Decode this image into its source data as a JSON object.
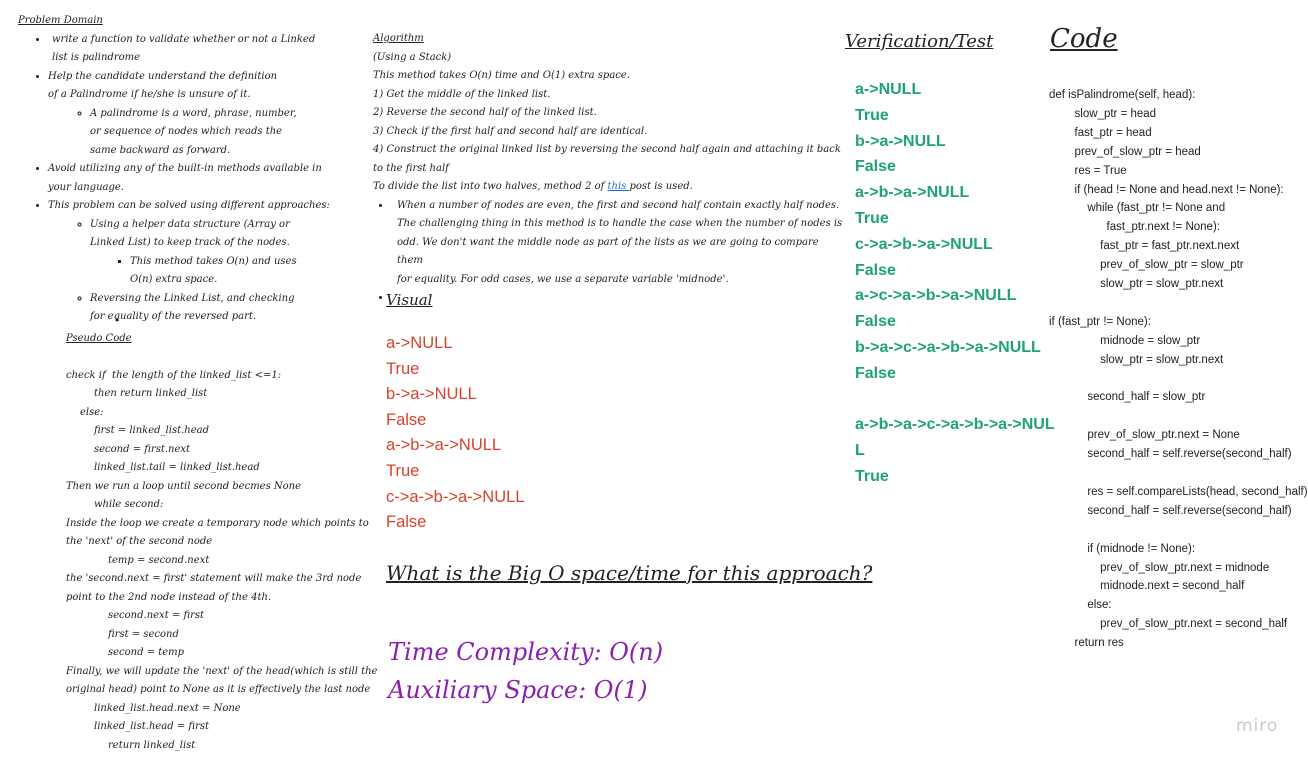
{
  "problem_domain": {
    "title": "Problem Domain",
    "bullets": [
      "write a function to validate whether or not a Linked list is palindrome",
      "Help the candidate understand the definition of a Palindrome if he/she is unsure of it.",
      "Avoid utilizing any of the built-in methods available in your language.",
      "This problem can be solved using different approaches:"
    ],
    "sub_palindrome": "A palindrome is a word, phrase, number, or sequence of nodes which reads the same backward as forward.",
    "sub_approach_1": "Using a helper data structure (Array or Linked List) to keep track of the nodes.",
    "sub_approach_1_note": "This method takes O(n) and uses O(n) extra space.",
    "sub_approach_2": "Reversing the Linked List, and checking for equality of the reversed part."
  },
  "pseudo": {
    "title": "Pseudo Code",
    "lines": [
      {
        "t": "check if  the length of the linked_list <=1:",
        "c": "plain",
        "i": 0
      },
      {
        "t": "then return linked_list",
        "c": "purple",
        "i": 2
      },
      {
        "t": "else:",
        "c": "purple",
        "i": 1
      },
      {
        "t": "first = linked_list.head",
        "c": "purple",
        "i": 2
      },
      {
        "t": "second = first.next",
        "c": "purple",
        "i": 2
      },
      {
        "t": "linked_list.tail = linked_list.head",
        "c": "purple",
        "i": 2
      },
      {
        "t": "Then we run a loop until second becmes None",
        "c": "plain",
        "i": 0
      },
      {
        "t": "while second:",
        "c": "purple",
        "i": 2
      },
      {
        "t": "Inside the loop we create a temporary node which points to",
        "c": "plain",
        "i": 0
      },
      {
        "t": "the 'next' of the second node",
        "c": "plain",
        "i": 0
      },
      {
        "t": "temp = second.next",
        "c": "purple",
        "i": 3
      },
      {
        "t": "the 'second.next = first' statement will make the 3rd node",
        "c": "plain",
        "i": 0
      },
      {
        "t": "point to the 2nd node instead of the 4th.",
        "c": "plain",
        "i": 0
      },
      {
        "t": "second.next = first",
        "c": "purple",
        "i": 3
      },
      {
        "t": "first = second",
        "c": "purple",
        "i": 3
      },
      {
        "t": "second = temp",
        "c": "purple",
        "i": 3
      },
      {
        "t": "Finally, we will update the 'next' of the head(which is still the",
        "c": "plain",
        "i": 0
      },
      {
        "t": "original head) point to None as it is effectively the last node",
        "c": "plain",
        "i": 0
      },
      {
        "t": "linked_list.head.next = None",
        "c": "purple",
        "i": 2
      },
      {
        "t": "linked_list.head = first",
        "c": "purple",
        "i": 2
      },
      {
        "t": "return linked_list",
        "c": "purple",
        "i": 3
      }
    ]
  },
  "algorithm": {
    "title": "Algorithm",
    "lines": [
      "(Using a Stack)",
      "This method takes O(n) time and O(1) extra space.",
      "1) Get the middle of the linked list.",
      "2) Reverse the second half of the linked list.",
      "3) Check if the first half and second half are identical.",
      "4) Construct the original linked list by reversing the second half again and attaching it back",
      "to the first half"
    ],
    "divide_before": "To divide the list into two halves, method 2 of ",
    "divide_link": "this ",
    "divide_after": "post is used.",
    "note_lines": [
      "When a number of nodes are even, the first and second half contain exactly half nodes.",
      "The challenging thing in this method is to handle the case when the number of nodes is",
      "odd. We don't want the middle node as part of the lists as we are going to compare them",
      "for equality. For odd cases, we use a separate variable 'midnode'."
    ]
  },
  "visual": {
    "title": "Visual",
    "lines": [
      "a->NULL",
      "True",
      "b->a->NULL",
      "False",
      "a->b->a->NULL",
      "True",
      "c->a->b->a->NULL",
      "False"
    ]
  },
  "bigo": {
    "question": "What is the Big O space/time for this approach?",
    "time": "Time Complexity: O(n)",
    "space": "Auxiliary Space: O(1)"
  },
  "verification": {
    "title": "Verification/Test",
    "lines": [
      "a->NULL",
      "True",
      "b->a->NULL",
      "False",
      "a->b->a->NULL",
      "True",
      "c->a->b->a->NULL",
      "False",
      "a->c->a->b->a->NULL",
      "False",
      "b->a->c->a->b->a->NULL",
      "False"
    ],
    "extra_lines": [
      "a->b->a->c->a->b->a->NUL",
      "L",
      "True"
    ]
  },
  "code": {
    "title": "Code",
    "lines": [
      "def isPalindrome(self, head):",
      "        slow_ptr = head",
      "        fast_ptr = head",
      "        prev_of_slow_ptr = head",
      "        res = True",
      "        if (head != None and head.next != None):",
      "            while (fast_ptr != None and",
      "                  fast_ptr.next != None):",
      "                fast_ptr = fast_ptr.next.next",
      "                prev_of_slow_ptr = slow_ptr",
      "                slow_ptr = slow_ptr.next",
      "",
      "if (fast_ptr != None):",
      "                midnode = slow_ptr",
      "                slow_ptr = slow_ptr.next",
      "",
      "            second_half = slow_ptr",
      "",
      "            prev_of_slow_ptr.next = None",
      "            second_half = self.reverse(second_half)",
      "",
      "            res = self.compareLists(head, second_half)",
      "            second_half = self.reverse(second_half)",
      "",
      "            if (midnode != None):",
      "                prev_of_slow_ptr.next = midnode",
      "                midnode.next = second_half",
      "            else:",
      "                prev_of_slow_ptr.next = second_half",
      "        return res"
    ]
  },
  "brand": "miro",
  "colors": {
    "red": "#d7422c",
    "green": "#1fa27a",
    "purple": "#8a1fb0",
    "pseudo_purple": "#5b2ea6",
    "link": "#1a6fd1"
  }
}
